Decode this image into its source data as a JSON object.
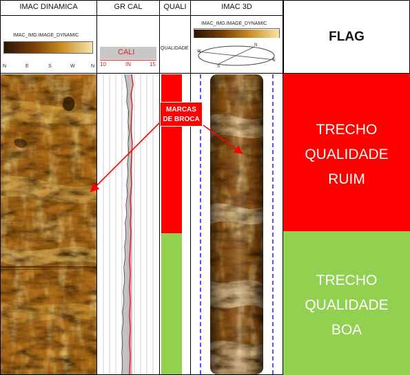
{
  "tracks": {
    "imac_dinamica": {
      "header": "IMAC DINAMICA",
      "scale_label": "IMAC_IMG.IMAGE_DYNAMIC",
      "scale_min": "0",
      "scale_max": "0",
      "azimuth_labels": [
        "N",
        "E",
        "S",
        "W",
        "N"
      ]
    },
    "gr_cal": {
      "header": "GR CAL",
      "curve_name": "CALI",
      "scale_min": "10",
      "unit": "IN",
      "scale_max": "15"
    },
    "quali": {
      "header": "QUALI",
      "curve_name": "QUALIDADE"
    },
    "imac_3d": {
      "header": "IMAC 3D",
      "scale_label": "IMAC_IMG.IMAGE_DYNAMIC",
      "compass_labels": [
        "N",
        "E",
        "S",
        "W"
      ]
    }
  },
  "flag": {
    "header": "FLAG",
    "zones": [
      {
        "lines": [
          "TRECHO",
          "QUALIDADE",
          "RUIM"
        ],
        "color": "#ff0000"
      },
      {
        "lines": [
          "TRECHO",
          "QUALIDADE",
          "BOA"
        ],
        "color": "#92d050"
      }
    ]
  },
  "quality_zones": [
    {
      "from": 0.0,
      "to": 0.53,
      "color": "#ff0000"
    },
    {
      "from": 0.53,
      "to": 1.0,
      "color": "#92d050"
    }
  ],
  "annotation": {
    "lines": [
      "MARCAS",
      "DE BROCA"
    ],
    "color": "#ff0000"
  },
  "colors": {
    "image_dark": "#3a1e05",
    "image_mid": "#b06a12",
    "image_light": "#f3d27a",
    "curve_red": "#e02020"
  }
}
